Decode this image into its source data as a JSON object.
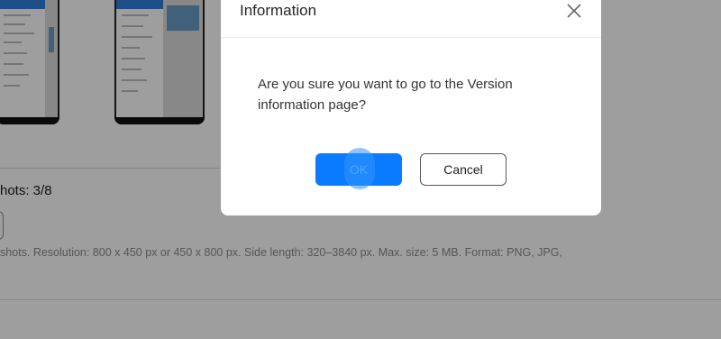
{
  "background": {
    "screenshots_label": "hots: 3/8",
    "hint_text": "shots. Resolution: 800 x 450 px or 450 x 800 px. Side length: 320–3840 px. Max. size: 5 MB. Format: PNG, JPG,"
  },
  "dialog": {
    "title": "Information",
    "message": "Are you sure you want to go to the Version information page?",
    "ok_label": "OK",
    "cancel_label": "Cancel",
    "close_icon": "close-icon"
  },
  "colors": {
    "primary": "#0a7bff",
    "overlay": "rgba(0,0,0,0.38)"
  }
}
